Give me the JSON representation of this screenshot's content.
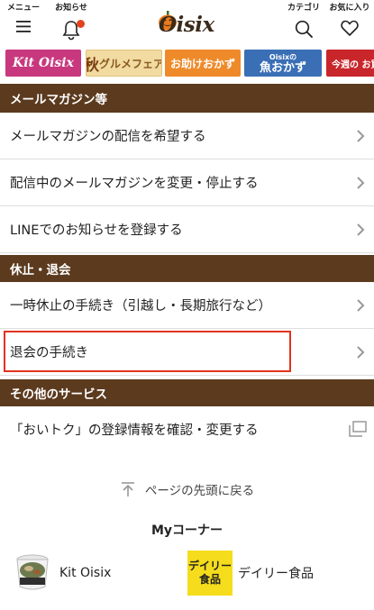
{
  "header": {
    "menu_label": "メニュー",
    "notice_label": "お知らせ",
    "logo_text": "Oisix",
    "category_label": "カテゴリ",
    "favorite_label": "お気に入り"
  },
  "banners": [
    {
      "text": "Kit Oisix"
    },
    {
      "big": "秋",
      "text": "グルメフェア"
    },
    {
      "text": "お助けおかず"
    },
    {
      "small": "Oisixの",
      "text": "魚おかず"
    },
    {
      "text": "今週の お買い"
    }
  ],
  "sections": [
    {
      "title": "メールマガジン等",
      "rows": [
        {
          "label": "メールマガジンの配信を希望する"
        },
        {
          "label": "配信中のメールマガジンを変更・停止する"
        },
        {
          "label": "LINEでのお知らせを登録する"
        }
      ]
    },
    {
      "title": "休止・退会",
      "rows": [
        {
          "label": "一時休止の手続き（引越し・長期旅行など）"
        },
        {
          "label": "退会の手続き"
        }
      ]
    },
    {
      "title": "その他のサービス",
      "rows": [
        {
          "label": "「おいトク」の登録情報を確認・変更する"
        }
      ]
    }
  ],
  "page_top": {
    "label": "ページの先頭に戻る"
  },
  "my_corner": {
    "title": "Myコーナー",
    "items": [
      {
        "label": "Kit Oisix"
      },
      {
        "thumb_line1": "デイリー",
        "thumb_line2": "食品",
        "label": "デイリー食品"
      }
    ]
  },
  "colors": {
    "section_bg": "#5b3a1e",
    "highlight": "#e2331f",
    "notice_badge": "#e2431e"
  }
}
